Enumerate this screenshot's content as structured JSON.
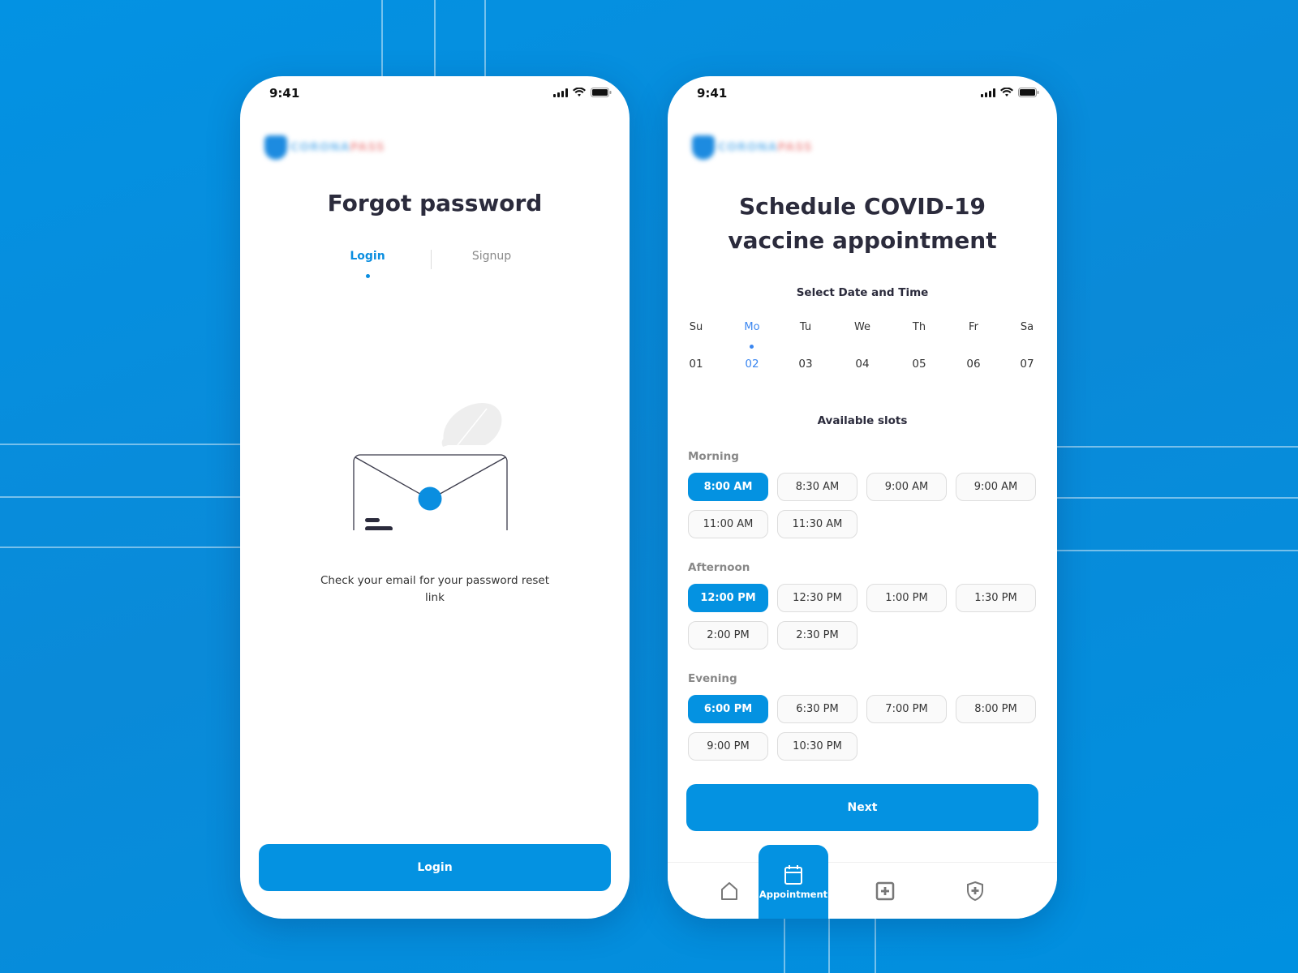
{
  "status_bar": {
    "time": "9:41"
  },
  "logo": {
    "part1": "CORONA",
    "part2": "PASS"
  },
  "forgot_screen": {
    "title": "Forgot password",
    "tabs": [
      {
        "label": "Login",
        "active": true
      },
      {
        "label": "Signup",
        "active": false
      }
    ],
    "message": "Check your email for your password reset link",
    "login_button": "Login"
  },
  "schedule_screen": {
    "title_line1": "Schedule COVID-19",
    "title_line2": "vaccine appointment",
    "date_heading": "Select Date and Time",
    "days": [
      {
        "name": "Su",
        "date": "01",
        "selected": false
      },
      {
        "name": "Mo",
        "date": "02",
        "selected": true
      },
      {
        "name": "Tu",
        "date": "03",
        "selected": false
      },
      {
        "name": "We",
        "date": "04",
        "selected": false
      },
      {
        "name": "Th",
        "date": "05",
        "selected": false
      },
      {
        "name": "Fr",
        "date": "06",
        "selected": false
      },
      {
        "name": "Sa",
        "date": "07",
        "selected": false
      }
    ],
    "slots_heading": "Available slots",
    "periods": [
      {
        "label": "Morning",
        "slots": [
          "8:00 AM",
          "8:30 AM",
          "9:00 AM",
          "9:00 AM",
          "11:00 AM",
          "11:30 AM"
        ],
        "selected": "8:00 AM"
      },
      {
        "label": "Afternoon",
        "slots": [
          "12:00 PM",
          "12:30 PM",
          "1:00 PM",
          "1:30 PM",
          "2:00 PM",
          "2:30 PM"
        ],
        "selected": "12:00 PM"
      },
      {
        "label": "Evening",
        "slots": [
          "6:00 PM",
          "6:30 PM",
          "7:00 PM",
          "8:00 PM",
          "9:00 PM",
          "10:30 PM"
        ],
        "selected": "6:00 PM"
      }
    ],
    "next_button": "Next",
    "nav": [
      {
        "icon": "home-icon",
        "label": "",
        "active": false
      },
      {
        "icon": "calendar-icon",
        "label": "Appointment",
        "active": true
      },
      {
        "icon": "medical-plus-icon",
        "label": "",
        "active": false
      },
      {
        "icon": "shield-plus-icon",
        "label": "",
        "active": false
      }
    ]
  },
  "colors": {
    "primary": "#0492e1",
    "background": "#038fe0",
    "text_dark": "#2b2b3c",
    "accent_day": "#3a86f0"
  }
}
